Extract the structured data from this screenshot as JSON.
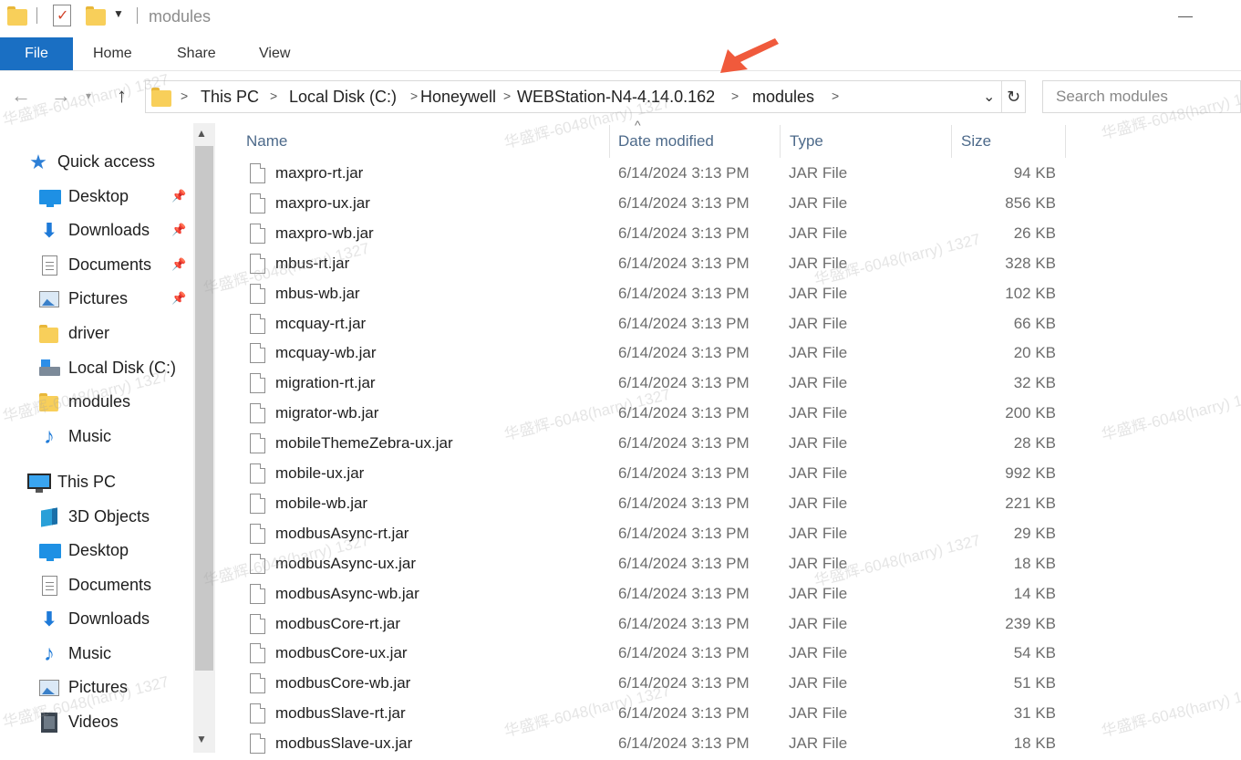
{
  "window": {
    "title": "modules"
  },
  "ribbon": {
    "tabs": [
      "File",
      "Home",
      "Share",
      "View"
    ]
  },
  "address": {
    "crumbs": [
      "This PC",
      "Local Disk (C:)",
      "Honeywell",
      "WEBStation-N4-4.14.0.162",
      "modules"
    ],
    "separator": ">"
  },
  "search": {
    "placeholder": "Search modules"
  },
  "nav": {
    "quick_access": "Quick access",
    "quick_items": [
      {
        "label": "Desktop",
        "icon": "desktop-icon",
        "pinned": true
      },
      {
        "label": "Downloads",
        "icon": "downloads-icon",
        "pinned": true
      },
      {
        "label": "Documents",
        "icon": "documents-icon",
        "pinned": true
      },
      {
        "label": "Pictures",
        "icon": "pictures-icon",
        "pinned": true
      },
      {
        "label": "driver",
        "icon": "folder-icon",
        "pinned": false
      },
      {
        "label": "Local Disk (C:)",
        "icon": "local-disk-icon",
        "pinned": false
      },
      {
        "label": "modules",
        "icon": "folder-icon",
        "pinned": false
      },
      {
        "label": "Music",
        "icon": "music-icon",
        "pinned": false
      }
    ],
    "this_pc": "This PC",
    "pc_items": [
      {
        "label": "3D Objects",
        "icon": "3d-objects-icon"
      },
      {
        "label": "Desktop",
        "icon": "desktop-icon"
      },
      {
        "label": "Documents",
        "icon": "documents-icon"
      },
      {
        "label": "Downloads",
        "icon": "downloads-icon"
      },
      {
        "label": "Music",
        "icon": "music-icon"
      },
      {
        "label": "Pictures",
        "icon": "pictures-icon"
      },
      {
        "label": "Videos",
        "icon": "videos-icon"
      }
    ]
  },
  "columns": {
    "name": "Name",
    "date": "Date modified",
    "type": "Type",
    "size": "Size"
  },
  "files": [
    {
      "name": "maxpro-rt.jar",
      "date": "6/14/2024 3:13 PM",
      "type": "JAR File",
      "size": "94 KB"
    },
    {
      "name": "maxpro-ux.jar",
      "date": "6/14/2024 3:13 PM",
      "type": "JAR File",
      "size": "856 KB"
    },
    {
      "name": "maxpro-wb.jar",
      "date": "6/14/2024 3:13 PM",
      "type": "JAR File",
      "size": "26 KB"
    },
    {
      "name": "mbus-rt.jar",
      "date": "6/14/2024 3:13 PM",
      "type": "JAR File",
      "size": "328 KB"
    },
    {
      "name": "mbus-wb.jar",
      "date": "6/14/2024 3:13 PM",
      "type": "JAR File",
      "size": "102 KB"
    },
    {
      "name": "mcquay-rt.jar",
      "date": "6/14/2024 3:13 PM",
      "type": "JAR File",
      "size": "66 KB"
    },
    {
      "name": "mcquay-wb.jar",
      "date": "6/14/2024 3:13 PM",
      "type": "JAR File",
      "size": "20 KB"
    },
    {
      "name": "migration-rt.jar",
      "date": "6/14/2024 3:13 PM",
      "type": "JAR File",
      "size": "32 KB"
    },
    {
      "name": "migrator-wb.jar",
      "date": "6/14/2024 3:13 PM",
      "type": "JAR File",
      "size": "200 KB"
    },
    {
      "name": "mobileThemeZebra-ux.jar",
      "date": "6/14/2024 3:13 PM",
      "type": "JAR File",
      "size": "28 KB"
    },
    {
      "name": "mobile-ux.jar",
      "date": "6/14/2024 3:13 PM",
      "type": "JAR File",
      "size": "992 KB"
    },
    {
      "name": "mobile-wb.jar",
      "date": "6/14/2024 3:13 PM",
      "type": "JAR File",
      "size": "221 KB"
    },
    {
      "name": "modbusAsync-rt.jar",
      "date": "6/14/2024 3:13 PM",
      "type": "JAR File",
      "size": "29 KB"
    },
    {
      "name": "modbusAsync-ux.jar",
      "date": "6/14/2024 3:13 PM",
      "type": "JAR File",
      "size": "18 KB"
    },
    {
      "name": "modbusAsync-wb.jar",
      "date": "6/14/2024 3:13 PM",
      "type": "JAR File",
      "size": "14 KB"
    },
    {
      "name": "modbusCore-rt.jar",
      "date": "6/14/2024 3:13 PM",
      "type": "JAR File",
      "size": "239 KB"
    },
    {
      "name": "modbusCore-ux.jar",
      "date": "6/14/2024 3:13 PM",
      "type": "JAR File",
      "size": "54 KB"
    },
    {
      "name": "modbusCore-wb.jar",
      "date": "6/14/2024 3:13 PM",
      "type": "JAR File",
      "size": "51 KB"
    },
    {
      "name": "modbusSlave-rt.jar",
      "date": "6/14/2024 3:13 PM",
      "type": "JAR File",
      "size": "31 KB"
    },
    {
      "name": "modbusSlave-ux.jar",
      "date": "6/14/2024 3:13 PM",
      "type": "JAR File",
      "size": "18 KB"
    }
  ],
  "watermark": "华盛辉-6048(harry) 1327",
  "colors": {
    "file_tab": "#1a6fc3",
    "annotation_arrow": "#f05a3c"
  }
}
